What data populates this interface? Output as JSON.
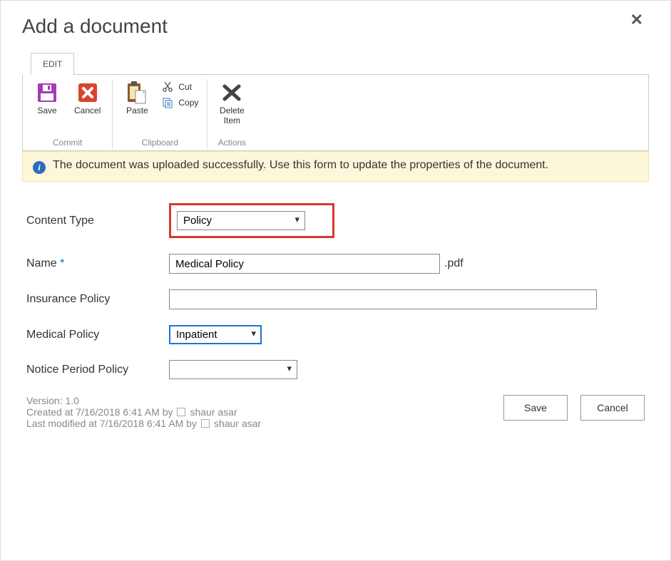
{
  "dialog": {
    "title": "Add a document"
  },
  "ribbon": {
    "tab_edit": "EDIT",
    "save": "Save",
    "cancel": "Cancel",
    "paste": "Paste",
    "cut": "Cut",
    "copy": "Copy",
    "delete_item": "Delete\nItem",
    "group_commit": "Commit",
    "group_clipboard": "Clipboard",
    "group_actions": "Actions"
  },
  "banner": {
    "message": "The document was uploaded successfully. Use this form to update the properties of the document."
  },
  "form": {
    "content_type_label": "Content Type",
    "content_type_value": "Policy",
    "name_label": "Name",
    "name_value": "Medical Policy",
    "name_ext": ".pdf",
    "insurance_policy_label": "Insurance Policy",
    "insurance_policy_value": "",
    "medical_policy_label": "Medical Policy",
    "medical_policy_value": "Inpatient",
    "notice_period_label": "Notice Period Policy",
    "notice_period_value": ""
  },
  "meta": {
    "version_label": "Version: 1.0",
    "created_prefix": "Created at 7/16/2018 6:41 AM  by",
    "created_user": "shaur asar",
    "modified_prefix": "Last modified at 7/16/2018 6:41 AM  by",
    "modified_user": "shaur asar"
  },
  "footer": {
    "save": "Save",
    "cancel": "Cancel"
  }
}
